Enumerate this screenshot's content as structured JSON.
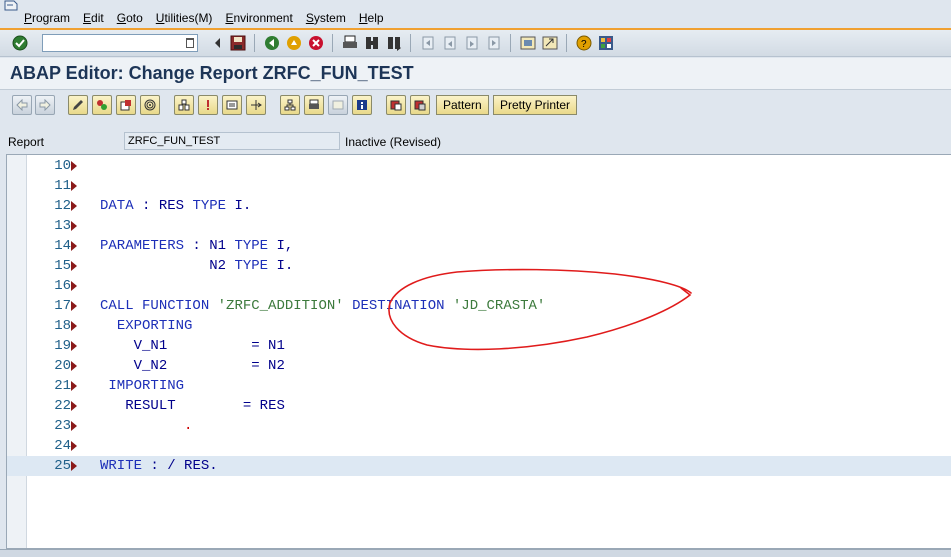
{
  "menu": [
    "Program",
    "Edit",
    "Goto",
    "Utilities(M)",
    "Environment",
    "System",
    "Help"
  ],
  "command_field": {
    "value": ""
  },
  "title": "ABAP Editor: Change Report ZRFC_FUN_TEST",
  "app_toolbar": {
    "pattern_label": "Pattern",
    "pretty_printer_label": "Pretty Printer"
  },
  "report": {
    "label": "Report",
    "value": "ZRFC_FUN_TEST",
    "status": "Inactive (Revised)"
  },
  "editor": {
    "lines": [
      {
        "num": "10",
        "text": ""
      },
      {
        "num": "11",
        "text": ""
      },
      {
        "num": "12",
        "text": "DATA : RES TYPE I."
      },
      {
        "num": "13",
        "text": ""
      },
      {
        "num": "14",
        "text": "PARAMETERS : N1 TYPE I,"
      },
      {
        "num": "15",
        "text": "             N2 TYPE I."
      },
      {
        "num": "16",
        "text": ""
      },
      {
        "num": "17",
        "text": "CALL FUNCTION 'ZRFC_ADDITION' DESTINATION 'JD_CRASTA'"
      },
      {
        "num": "18",
        "text": "  EXPORTING"
      },
      {
        "num": "19",
        "text": "    V_N1          = N1"
      },
      {
        "num": "20",
        "text": "    V_N2          = N2"
      },
      {
        "num": "21",
        "text": " IMPORTING"
      },
      {
        "num": "22",
        "text": "   RESULT        = RES"
      },
      {
        "num": "23",
        "text": "          ."
      },
      {
        "num": "24",
        "text": ""
      },
      {
        "num": "25",
        "text": "WRITE : / RES."
      }
    ],
    "highlighted_line": "25"
  },
  "colors": {
    "keyword": "#1d2fb8",
    "string": "#3c7a3c",
    "annotation": "#e01b1b",
    "title": "#1d3557",
    "menu_accent": "#f0a030"
  }
}
